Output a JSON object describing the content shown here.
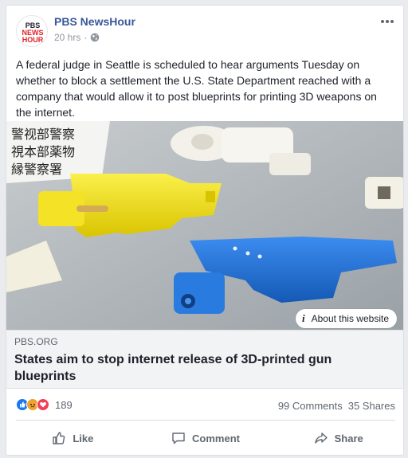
{
  "post": {
    "page_name": "PBS NewsHour",
    "logo_text": [
      "PBS",
      "NEWS",
      "HOUR"
    ],
    "time": "20 hrs",
    "separator": "·",
    "audience_icon": "globe-icon",
    "text": "A federal judge in Seattle is scheduled to hear arguments Tuesday on whether to block a settlement the U.S. State Department reached with a company that would allow it to post blueprints for printing 3D weapons on the internet."
  },
  "link": {
    "about_label": "About this website",
    "domain": "PBS.ORG",
    "headline": "States aim to stop internet release of 3D-printed gun blueprints"
  },
  "stats": {
    "reaction_icons": [
      "like-icon",
      "angry-icon",
      "love-icon"
    ],
    "reaction_count": "189",
    "comments": "99 Comments",
    "shares": "35 Shares"
  },
  "actions": {
    "like": "Like",
    "comment": "Comment",
    "share": "Share"
  },
  "colors": {
    "link_blue": "#385898",
    "meta_grey": "#90949c",
    "like_blue": "#1877f2",
    "yellow_gun": "#f5e71c",
    "blue_gun": "#1c6fd8"
  }
}
